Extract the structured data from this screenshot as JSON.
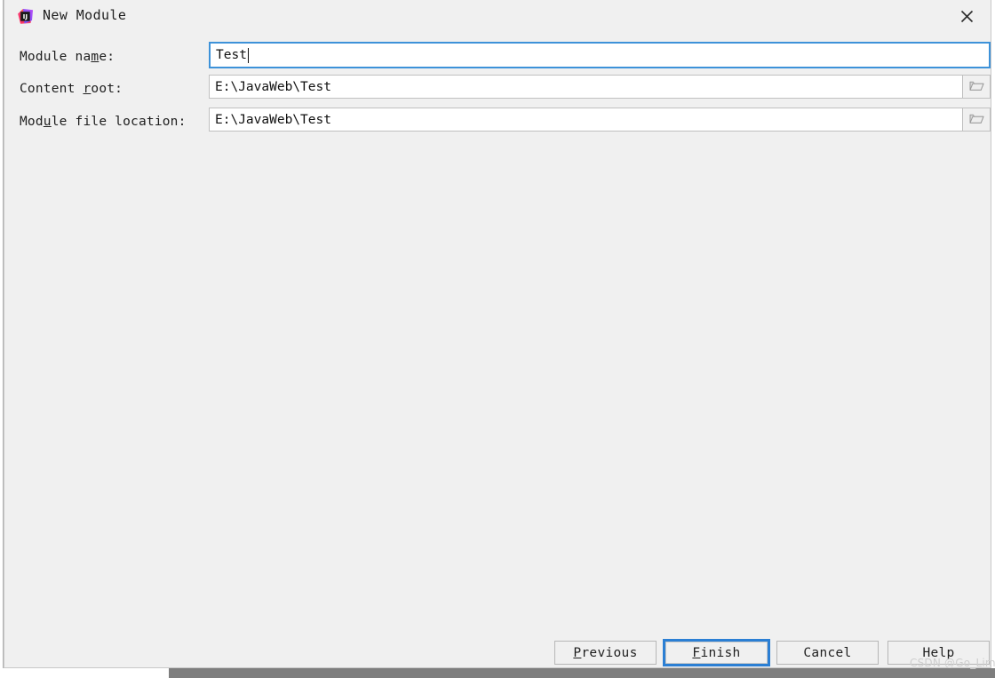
{
  "window": {
    "title": "New Module",
    "app_icon": "intellij-idea-icon",
    "close_icon": "close-icon",
    "background_color": "#f0f0f0",
    "accent_color": "#3d92d9",
    "focus_ring_color": "#2b7fd4"
  },
  "form": {
    "fields": [
      {
        "label_prefix": "Module na",
        "label_mnemonic": "m",
        "label_suffix": "e:",
        "value": "Test",
        "focused": true,
        "has_browse": false
      },
      {
        "label_prefix": "Content ",
        "label_mnemonic": "r",
        "label_suffix": "oot:",
        "value": "E:\\JavaWeb\\Test",
        "focused": false,
        "has_browse": true,
        "browse_icon": "folder-icon"
      },
      {
        "label_prefix": "Mod",
        "label_mnemonic": "u",
        "label_suffix": "le file location:",
        "value": "E:\\JavaWeb\\Test",
        "focused": false,
        "has_browse": true,
        "browse_icon": "folder-icon"
      }
    ]
  },
  "footer": {
    "previous": {
      "prefix": "",
      "mnemonic": "P",
      "suffix": "revious"
    },
    "finish": {
      "prefix": "",
      "mnemonic": "F",
      "suffix": "inish",
      "default": true
    },
    "cancel": {
      "label": "Cancel"
    },
    "help": {
      "label": "Help"
    }
  },
  "watermark": {
    "text": "CSDN @Go_Lim"
  }
}
